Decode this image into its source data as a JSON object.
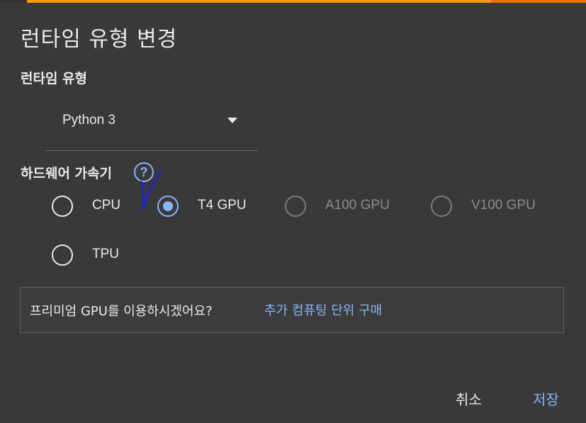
{
  "dialog": {
    "title": "런타임 유형 변경",
    "runtime_section_label": "런타임 유형",
    "runtime_select": {
      "value": "Python 3"
    },
    "accelerator_section_label": "하드웨어 가속기",
    "help_icon": "?",
    "accelerators": [
      {
        "label": "CPU",
        "selected": false,
        "disabled": false
      },
      {
        "label": "T4 GPU",
        "selected": true,
        "disabled": false
      },
      {
        "label": "A100 GPU",
        "selected": false,
        "disabled": true
      },
      {
        "label": "V100 GPU",
        "selected": false,
        "disabled": true
      },
      {
        "label": "TPU",
        "selected": false,
        "disabled": false
      }
    ],
    "premium": {
      "question": "프리미엄 GPU를 이용하시겠어요?",
      "link": "추가 컴퓨팅 단위 구매"
    },
    "buttons": {
      "cancel": "취소",
      "save": "저장"
    }
  },
  "colors": {
    "background": "#393939",
    "accent": "#8ab4f8",
    "top_bar": "#f59b05",
    "annotation_ink": "#1a1aff"
  }
}
